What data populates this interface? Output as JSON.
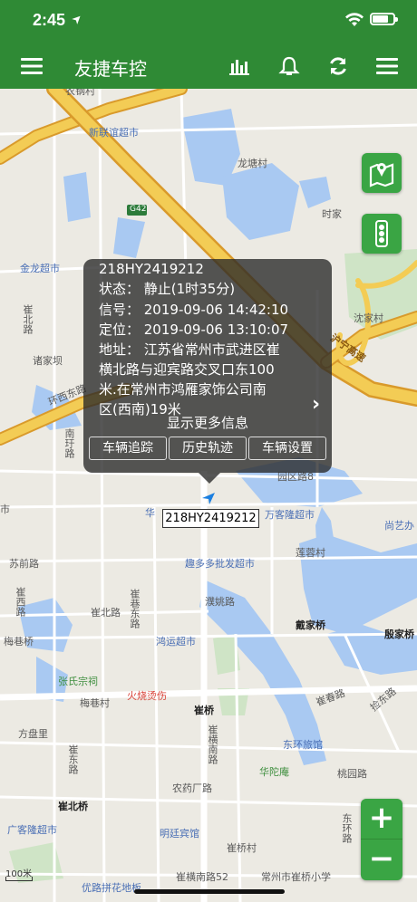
{
  "status_bar": {
    "time": "2:45",
    "location_glyph": "➤"
  },
  "app_bar": {
    "title": "友捷车控",
    "icons": [
      "menu-icon",
      "bar-chart-icon",
      "bell-icon",
      "refresh-icon",
      "list-icon"
    ]
  },
  "map_labels": {
    "nongang": "农钢村",
    "xinlianyi": "新联谊超市",
    "longtang": "龙塘村",
    "g42": "G42",
    "shijia": "时家",
    "jinlong": "金龙超市",
    "cuibeilu": "崔北路",
    "zhujiaba": "诸家坝",
    "shenjia": "沈家村",
    "huning": "沪宁高速",
    "huanyuan": "环西东路",
    "nanjing": "南玗路",
    "yuanqu": "园区路8",
    "hua": "华",
    "shi": "市",
    "wankelong": "万客隆超市",
    "shangyi": "尚艺办",
    "qiansu": "苏前路",
    "lianrong": "莲蓉村",
    "quduoduo": "趣多多批发超市",
    "cuixilu": "崔西路",
    "cuibei": "崔北路",
    "cuixiang": "崔巷东路",
    "puyao": "濮姚路",
    "daijiaqiao": "戴家桥",
    "yinjiaqiao": "殷家桥",
    "meixiangqiao": "梅巷桥",
    "hongyun": "鸿运超市",
    "zhangshi": "张氏宗祠",
    "meixiang": "梅巷村",
    "huoshao": "火烧烫伤",
    "cuiqiao": "崔桥",
    "cuichun": "崔春路",
    "jiandong": "捡东路",
    "fangpanli": "方盘里",
    "cuiheng": "崔横南路",
    "dongh": "东环旅馆",
    "hualong": "华陀庵",
    "taoyuan": "桃园路",
    "nongyao": "农药厂路",
    "cuibeiqiao": "崔北桥",
    "guangke": "广客隆超市",
    "mingting": "明廷宾馆",
    "cuiqiaocun": "崔桥村",
    "dongji": "东环路",
    "youlu": "优路拼花地板",
    "cuihengnan52": "崔横南路52",
    "xiaoxue": "常州市崔桥小学",
    "cuidong": "崔东路"
  },
  "popup": {
    "plate": "218HY2419212",
    "status": "状态：  静止(1时35分)",
    "signal": "信号：  2019-09-06 14:42:10",
    "position": "定位：  2019-09-06 13:10:07",
    "address_1": "地址：  江苏省常州市武进区崔",
    "address_2": "横北路与迎宾路交叉口东100",
    "address_3": "米.在常州市鸿雁家饰公司南",
    "address_4": "区(西南)19米",
    "more_info": "显示更多信息",
    "buttons": [
      "车辆追踪",
      "历史轨迹",
      "车辆设置"
    ]
  },
  "vehicle_label": "218HY2419212",
  "scale_label": "100米",
  "colors": {
    "bar": "#2f8a35",
    "accent": "#3aa544",
    "highway": "#e6b830"
  }
}
